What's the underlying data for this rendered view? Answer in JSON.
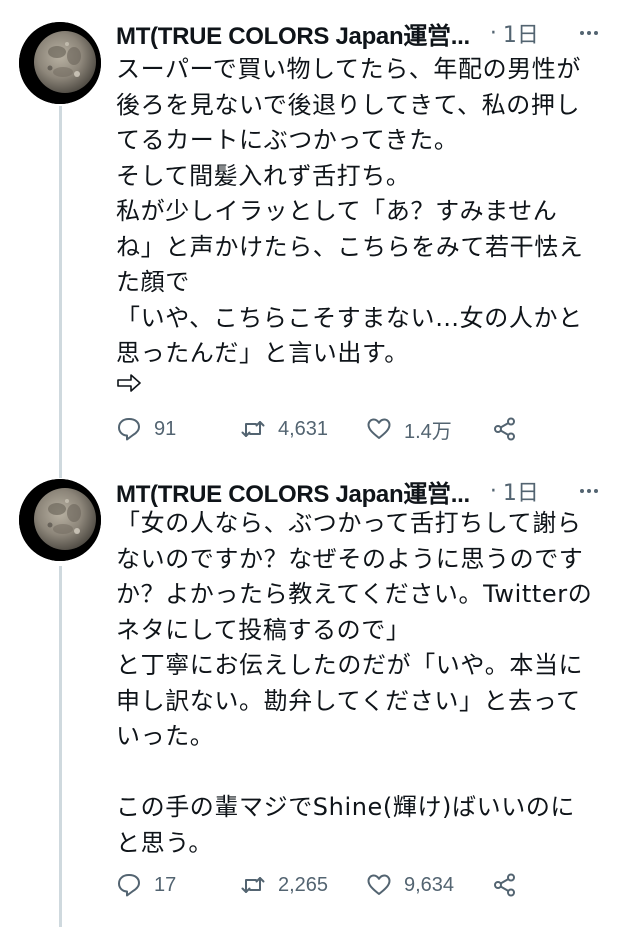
{
  "tweets": [
    {
      "author": "MT(TRUE COLORS Japan運営...",
      "separator": "·",
      "time": "1日",
      "lines": [
        "スーパーで買い物してたら、年配の男性が",
        "後ろを見ないで後退りしてきて、私の押し",
        "てるカートにぶつかってきた。",
        "そして間髪入れず舌打ち。",
        "私が少しイラッとして「あ？すみません",
        "ね」と声かけたら、こちらをみて若干怯え",
        "た顔で",
        "「いや、こちらこそすまない…女の人かと",
        "思ったんだ」と言い出す。"
      ],
      "continuation_icon": "right-arrow-emoji",
      "stats": {
        "replies": "91",
        "retweets": "4,631",
        "likes": "1.4万"
      }
    },
    {
      "author": "MT(TRUE COLORS Japan運営...",
      "separator": "·",
      "time": "1日",
      "lines": [
        "「女の人なら、ぶつかって舌打ちして謝ら",
        "ないのですか？なぜそのように思うのです",
        "か？よかったら教えてください。Twitterの",
        "ネタにして投稿するので」",
        "と丁寧にお伝えしたのだが「いや。本当に",
        "申し訳ない。勘弁してください」と去って",
        "いった。",
        "",
        "この手の輩マジでShine(輝け)ばいいのに",
        "と思う。"
      ],
      "stats": {
        "replies": "17",
        "retweets": "2,265",
        "likes": "9,634"
      }
    }
  ],
  "colors": {
    "text": "#0f1419",
    "muted": "#536471",
    "thread_line": "#cfd9de",
    "background": "#ffffff"
  }
}
